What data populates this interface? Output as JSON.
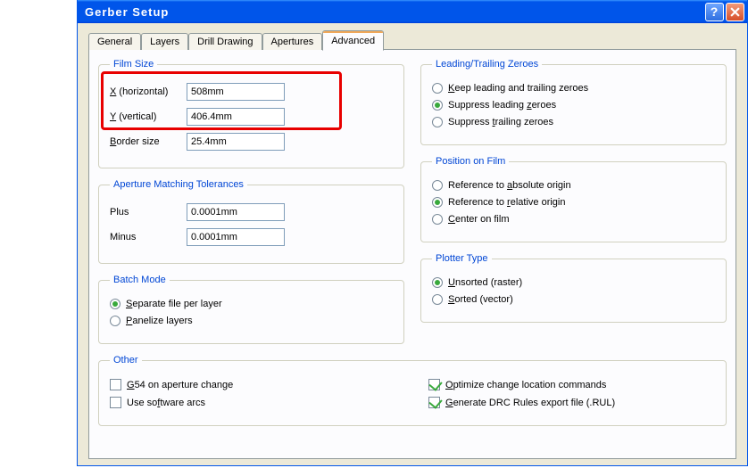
{
  "window": {
    "title": "Gerber Setup"
  },
  "tabs": [
    "General",
    "Layers",
    "Drill Drawing",
    "Apertures",
    "Advanced"
  ],
  "active_tab": "Advanced",
  "film_size": {
    "legend": "Film Size",
    "x_label_pre": "X",
    "x_label_post": " (horizontal)",
    "y_label_pre": "Y",
    "y_label_post": " (vertical)",
    "border_label_pre": "B",
    "border_label_post": "order size",
    "x_value": "508mm",
    "y_value": "406.4mm",
    "border_value": "25.4mm"
  },
  "aperture_tol": {
    "legend": "Aperture Matching Tolerances",
    "plus_label": "Plus",
    "minus_label": "Minus",
    "plus_value": "0.0001mm",
    "minus_value": "0.0001mm"
  },
  "batch_mode": {
    "legend": "Batch Mode",
    "separate_pre": "S",
    "separate_post": "eparate file per layer",
    "panelize_pre": "P",
    "panelize_post": "anelize layers",
    "selected": "separate"
  },
  "zeroes": {
    "legend": "Leading/Trailing Zeroes",
    "keep_pre": "K",
    "keep_post": "eep leading and trailing zeroes",
    "supl_pre": "Suppress leading ",
    "supl_u": "z",
    "supl_post": "eroes",
    "supt_pre": "Suppress ",
    "supt_u": "t",
    "supt_post": "railing zeroes",
    "selected": "suppress_leading"
  },
  "position": {
    "legend": "Position on Film",
    "abs_pre": "Reference to ",
    "abs_u": "a",
    "abs_post": "bsolute origin",
    "rel_pre": "Reference to ",
    "rel_u": "r",
    "rel_post": "elative origin",
    "center_pre": "C",
    "center_post": "enter on film",
    "selected": "relative"
  },
  "plotter": {
    "legend": "Plotter Type",
    "unsorted_pre": "U",
    "unsorted_post": "nsorted (raster)",
    "sorted_pre": "S",
    "sorted_post": "orted (vector)",
    "selected": "unsorted"
  },
  "other": {
    "legend": "Other",
    "g54_pre": "G",
    "g54_post": "54 on aperture change",
    "arcs_pre": "Use so",
    "arcs_u": "f",
    "arcs_post": "tware arcs",
    "opt_pre": "O",
    "opt_post": "ptimize change location commands",
    "drc_pre": "G",
    "drc_post": "enerate DRC Rules export file (.RUL)",
    "g54": false,
    "arcs": false,
    "opt": true,
    "drc": true
  }
}
